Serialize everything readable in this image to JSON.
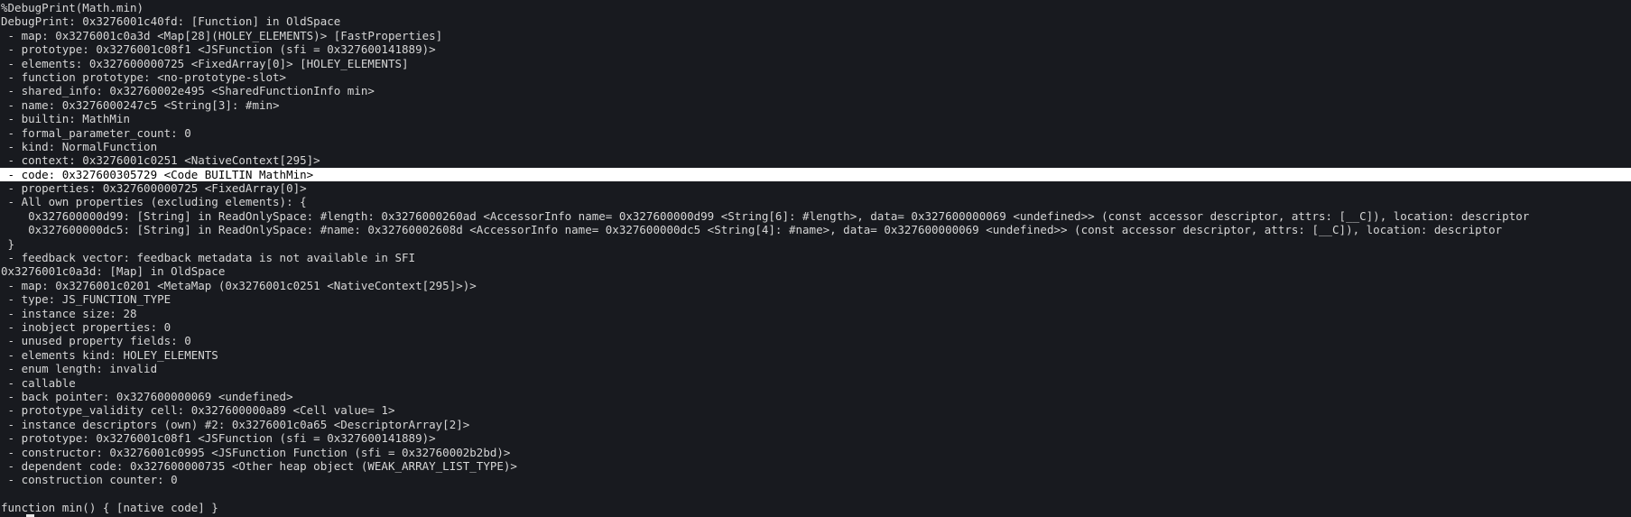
{
  "terminal": {
    "lines": [
      "%DebugPrint(Math.min)",
      "DebugPrint: 0x3276001c40fd: [Function] in OldSpace",
      " - map: 0x3276001c0a3d <Map[28](HOLEY_ELEMENTS)> [FastProperties]",
      " - prototype: 0x3276001c08f1 <JSFunction (sfi = 0x327600141889)>",
      " - elements: 0x327600000725 <FixedArray[0]> [HOLEY_ELEMENTS]",
      " - function prototype: <no-prototype-slot>",
      " - shared_info: 0x32760002e495 <SharedFunctionInfo min>",
      " - name: 0x3276000247c5 <String[3]: #min>",
      " - builtin: MathMin",
      " - formal_parameter_count: 0",
      " - kind: NormalFunction",
      " - context: 0x3276001c0251 <NativeContext[295]>",
      " - code: 0x327600305729 <Code BUILTIN MathMin>",
      " - properties: 0x327600000725 <FixedArray[0]>",
      " - All own properties (excluding elements): {",
      "    0x327600000d99: [String] in ReadOnlySpace: #length: 0x3276000260ad <AccessorInfo name= 0x327600000d99 <String[6]: #length>, data= 0x327600000069 <undefined>> (const accessor descriptor, attrs: [__C]), location: descriptor",
      "    0x327600000dc5: [String] in ReadOnlySpace: #name: 0x32760002608d <AccessorInfo name= 0x327600000dc5 <String[4]: #name>, data= 0x327600000069 <undefined>> (const accessor descriptor, attrs: [__C]), location: descriptor",
      " }",
      " - feedback vector: feedback metadata is not available in SFI",
      "0x3276001c0a3d: [Map] in OldSpace",
      " - map: 0x3276001c0201 <MetaMap (0x3276001c0251 <NativeContext[295]>)>",
      " - type: JS_FUNCTION_TYPE",
      " - instance size: 28",
      " - inobject properties: 0",
      " - unused property fields: 0",
      " - elements kind: HOLEY_ELEMENTS",
      " - enum length: invalid",
      " - callable",
      " - back pointer: 0x327600000069 <undefined>",
      " - prototype_validity cell: 0x327600000a89 <Cell value= 1>",
      " - instance descriptors (own) #2: 0x3276001c0a65 <DescriptorArray[2]>",
      " - prototype: 0x3276001c08f1 <JSFunction (sfi = 0x327600141889)>",
      " - constructor: 0x3276001c0995 <JSFunction Function (sfi = 0x32760002b2bd)>",
      " - dependent code: 0x327600000735 <Other heap object (WEAK_ARRAY_LIST_TYPE)>",
      " - construction counter: 0",
      "",
      "function min() { [native code] }"
    ],
    "highlighted_line_index": 12
  }
}
